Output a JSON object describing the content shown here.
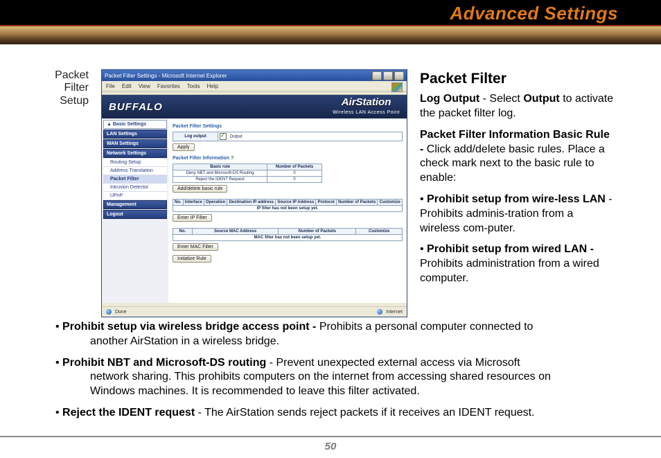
{
  "header": {
    "title": "Advanced Settings"
  },
  "page_number": "50",
  "caption": {
    "l1": "Packet",
    "l2": "Filter",
    "l3": "Setup"
  },
  "ie": {
    "title": "Packet Filter Settings - Microsoft Internet Explorer",
    "menu": [
      "File",
      "Edit",
      "View",
      "Favorites",
      "Tools",
      "Help"
    ],
    "brand_left": "BUFFALO",
    "brand_right_big": "AirStation",
    "brand_right_small": "Wireless LAN Access Point",
    "sidebar_basic_header": "▲ Basic Settings",
    "sidebar_sections": [
      "LAN Settings",
      "WAN Settings",
      "Network Settings"
    ],
    "sidebar_net_items": [
      "Routing Setup",
      "Address Translation",
      "Packet Filter",
      "Intrusion Detector",
      "UPnP"
    ],
    "sidebar_bottom": [
      "Management",
      "Logout"
    ],
    "panel": {
      "h1": "Packet Filter Settings",
      "log_label": "Log output",
      "log_checkbox": "Output",
      "apply": "Apply",
      "h2": "Packet Filter Information",
      "qmark": "?",
      "basicrule_h": [
        "Basic rule",
        "Number of Packets"
      ],
      "basicrule_rows": [
        [
          "Deny NBT and Microsoft-DS Routing",
          "0"
        ],
        [
          "Reject the IDENT Request",
          "0"
        ]
      ],
      "add_delete": "Add/delete basic rule",
      "ip_filter_headers": [
        "No.",
        "Interface",
        "Operation",
        "Destination IP address",
        "Source IP Address",
        "Protocol",
        "Number of Packets",
        "Customize"
      ],
      "ip_filter_msg": "IP filter has not been setup yet.",
      "enter_ip": "Enter IP Filter",
      "mac_headers": [
        "No.",
        "Source MAC Address",
        "Number of Packets",
        "Customize"
      ],
      "mac_msg": "MAC filter has not been setup yet.",
      "enter_mac": "Enter MAC Filter",
      "init": "Initialize Rule"
    },
    "status_left": "Done",
    "status_right": "Internet"
  },
  "right": {
    "h": "Packet Filter",
    "p1a": "Log Output",
    "p1b": " - Select ",
    "p1c": "Output",
    "p1d": " to activate the packet filter log.",
    "p2a": "Packet Filter Information Basic Rule - ",
    "p2b": "Click add/delete basic rules. Place a check mark next to the basic rule to enable:",
    "b1a": "Prohibit setup from wire-less LAN",
    "b1b": " - Prohibits adminis-tration from a wireless com-puter.",
    "b2a": "Prohibit setup from wired LAN - ",
    "b2b": "Prohibits administration from a wired computer."
  },
  "lower": {
    "b3a": "Prohibit setup via wireless bridge access point - ",
    "b3b": "Prohibits a personal computer connected to",
    "b3c": "another AirStation in a wireless bridge.",
    "b4a": "Prohibit NBT and Microsoft-DS routing",
    "b4b": " - Prevent unexpected external access via Microsoft",
    "b4c1": "network sharing.  This prohibits computers on the internet from accessing shared resources on",
    "b4c2": "Windows machines.  It is recommended to leave this filter activated.",
    "b5a": "Reject the IDENT request",
    "b5b": " - The AirStation sends reject packets if it receives an IDENT request."
  }
}
